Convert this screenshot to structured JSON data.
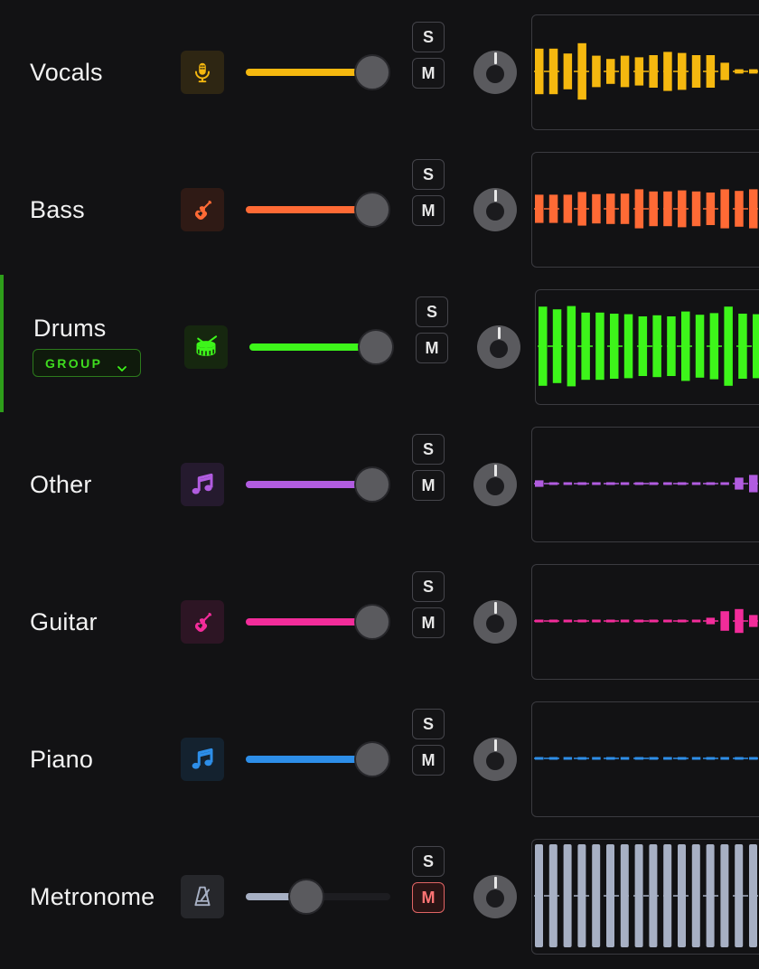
{
  "mixer": {
    "group_label": "GROUP",
    "solo_label": "S",
    "mute_label": "M",
    "tracks": [
      {
        "name": "Vocals",
        "color": "#f5b80f",
        "icon": "microphone-icon",
        "icon_bg": "#2e2613",
        "volume": 0.87,
        "solo": false,
        "mute": false,
        "selected": false,
        "waveform": [
          0.42,
          0.42,
          0.33,
          0.52,
          0.29,
          0.23,
          0.29,
          0.26,
          0.3,
          0.36,
          0.34,
          0.3,
          0.3,
          0.16,
          0.04,
          0.04,
          0.04
        ]
      },
      {
        "name": "Bass",
        "color": "#ff6a35",
        "icon": "guitar-icon",
        "icon_bg": "#2f1a15",
        "volume": 0.87,
        "solo": false,
        "mute": false,
        "selected": false,
        "waveform": [
          0.26,
          0.26,
          0.26,
          0.31,
          0.27,
          0.28,
          0.28,
          0.36,
          0.32,
          0.32,
          0.34,
          0.32,
          0.3,
          0.36,
          0.33,
          0.36,
          0.36
        ]
      },
      {
        "name": "Drums",
        "color": "#3df51a",
        "icon": "drum-icon",
        "icon_bg": "#16270f",
        "volume": 0.87,
        "solo": false,
        "mute": false,
        "selected": true,
        "waveform": [
          0.73,
          0.68,
          0.74,
          0.62,
          0.62,
          0.6,
          0.59,
          0.55,
          0.57,
          0.55,
          0.64,
          0.58,
          0.61,
          0.73,
          0.6,
          0.59,
          0.61
        ]
      },
      {
        "name": "Other",
        "color": "#b15ce0",
        "icon": "music-note-icon",
        "icon_bg": "#251a2e",
        "volume": 0.87,
        "solo": false,
        "mute": false,
        "selected": false,
        "waveform": [
          0.06,
          0.01,
          0.01,
          0.01,
          0.01,
          0.01,
          0.02,
          0.01,
          0.02,
          0.01,
          0.01,
          0.01,
          0.01,
          0.01,
          0.11,
          0.16,
          0.17
        ]
      },
      {
        "name": "Guitar",
        "color": "#f22c9a",
        "icon": "guitar-icon",
        "icon_bg": "#2d1524",
        "volume": 0.87,
        "solo": false,
        "mute": false,
        "selected": false,
        "waveform": [
          0.01,
          0.01,
          0.02,
          0.02,
          0.01,
          0.01,
          0.01,
          0.01,
          0.01,
          0.01,
          0.01,
          0.01,
          0.06,
          0.18,
          0.22,
          0.11,
          0.06
        ]
      },
      {
        "name": "Piano",
        "color": "#2d8ee8",
        "icon": "music-note-icon",
        "icon_bg": "#14222f",
        "volume": 0.87,
        "solo": false,
        "mute": false,
        "selected": false,
        "waveform": [
          0.01,
          0.01,
          0.01,
          0.01,
          0.01,
          0.01,
          0.01,
          0.01,
          0.01,
          0.01,
          0.01,
          0.01,
          0.01,
          0.01,
          0.01,
          0.01,
          0.01
        ]
      },
      {
        "name": "Metronome",
        "color": "#a7b0c4",
        "icon": "metronome-icon",
        "icon_bg": "#26272b",
        "volume": 0.42,
        "solo": false,
        "mute": true,
        "selected": false,
        "waveform": [
          0.95,
          0.95,
          0.95,
          0.95,
          0.95,
          0.95,
          0.95,
          0.95,
          0.95,
          0.95,
          0.95,
          0.95,
          0.95,
          0.95,
          0.95,
          0.95,
          0.95
        ]
      }
    ]
  }
}
